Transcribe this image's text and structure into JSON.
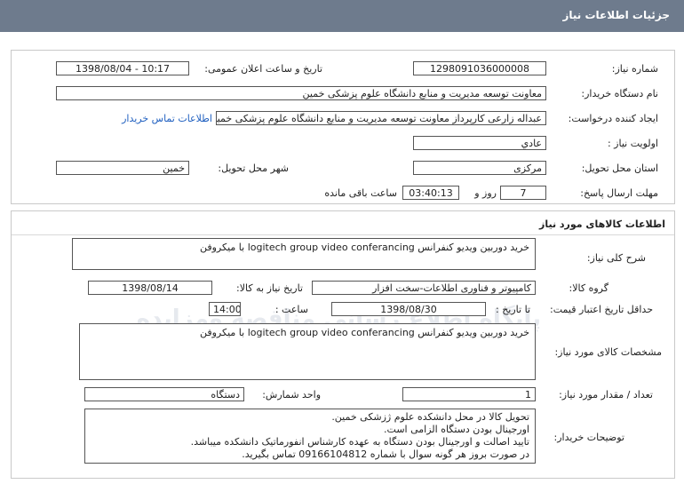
{
  "page": {
    "title": "جزئیات اطلاعات نیاز"
  },
  "need": {
    "number_label": "شماره نیاز:",
    "number": "1298091036000008",
    "announce_label": "تاریخ و ساعت اعلان عمومی:",
    "announce_value": "1398/08/04 - 10:17",
    "buyer_label": "نام دستگاه خریدار:",
    "buyer": "معاونت توسعه مدیریت و منابع دانشگاه علوم پزشکی خمین",
    "creator_label": "ایجاد کننده درخواست:",
    "creator": "عبداله زارعی کارپرداز معاونت توسعه مدیریت و منابع دانشگاه علوم پزشکی خمین",
    "contact_link": "اطلاعات تماس خریدار",
    "priority_label": "اولویت نیاز :",
    "priority": "عادي",
    "province_label": "استان محل تحویل:",
    "province": "مرکزی",
    "city_label": "شهر محل تحویل:",
    "city": "خمین",
    "deadline_label": "مهلت ارسال پاسخ:",
    "days": "7",
    "days_label": "روز و",
    "time_left": "03:40:13",
    "time_left_label": "ساعت باقی مانده"
  },
  "goods": {
    "section_title": "اطلاعات کالاهای مورد نیاز",
    "desc_label": "شرح کلی نیاز:",
    "desc": "خرید دوربین ویدیو کنفرانس logitech group video conferancing  با میکروفن",
    "group_label": "گروه کالا:",
    "group": "کامپیوتر و فناوری اطلاعات-سخت افزار",
    "need_date_label": "تاریخ نیاز به کالا:",
    "need_date": "1398/08/14",
    "validity_label": "حداقل تاریخ اعتبار قیمت:",
    "until_label": "تا تاریخ :",
    "validity_date": "1398/08/30",
    "hour_label": "ساعت :",
    "validity_time": "14:00",
    "specs_label": "مشخصات کالای مورد نیاز:",
    "specs": "خرید دوربین ویدیو کنفرانس logitech group video conferancing  با میکروفن",
    "qty_label": "تعداد / مقدار مورد نیاز:",
    "qty": "1",
    "unit_label": "واحد شمارش:",
    "unit": "دستگاه",
    "notes_label": "توضیحات خریدار:",
    "notes": [
      "تحویل کالا در محل دانشکده علوم ژزشکی خمین.",
      "اورجینال بودن دستگاه الزامی است.",
      "تایید اصالت و اورجینال بودن دستگاه به عهده کارشناس انفورماتیک دانشکده میباشد.",
      "در صورت بروز هر گونه سوال با شماره 09166104812 تماس بگیرید."
    ]
  },
  "watermark": {
    "line1": "پایگاه اطلاع رسانی مناقصه ومزایده",
    "line2": "۰۲۱-۸۸۳۴۹۶۷۰-۵"
  }
}
